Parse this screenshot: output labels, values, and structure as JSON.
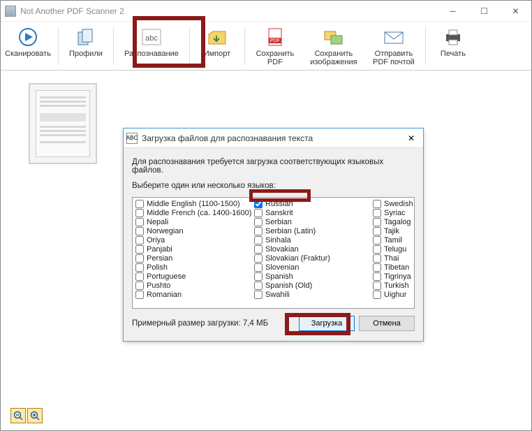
{
  "titlebar": {
    "title": "Not Another PDF Scanner 2"
  },
  "toolbar": {
    "items": [
      {
        "label": "Сканировать"
      },
      {
        "label": "Профили"
      },
      {
        "label": "Распознавание"
      },
      {
        "label": "Импорт"
      },
      {
        "label": "Сохранить\nPDF"
      },
      {
        "label": "Сохранить\nизображения"
      },
      {
        "label": "Отправить\nPDF почтой"
      },
      {
        "label": "Печать"
      }
    ]
  },
  "dialog": {
    "title": "Загрузка файлов для распознавания текста",
    "line1": "Для распознавания требуется загрузка соответствующих языковых файлов.",
    "line2": "Выберите один или несколько языков:",
    "size_label": "Примерный размер загрузки: 7,4 МБ",
    "ok": "Загрузка",
    "cancel": "Отмена",
    "columns": [
      [
        "Middle English (1100-1500)",
        "Middle French (ca. 1400-1600)",
        "Nepali",
        "Norwegian",
        "Oriya",
        "Panjabi",
        "Persian",
        "Polish",
        "Portuguese",
        "Pushto",
        "Romanian"
      ],
      [
        "Russian",
        "Sanskrit",
        "Serbian",
        "Serbian (Latin)",
        "Sinhala",
        "Slovakian",
        "Slovakian (Fraktur)",
        "Slovenian",
        "Spanish",
        "Spanish (Old)",
        "Swahili"
      ],
      [
        "Swedish",
        "Syriac",
        "Tagalog",
        "Tajik",
        "Tamil",
        "Telugu",
        "Thai",
        "Tibetan",
        "Tigrinya",
        "Turkish",
        "Uighur"
      ]
    ],
    "checked": "Russian"
  }
}
